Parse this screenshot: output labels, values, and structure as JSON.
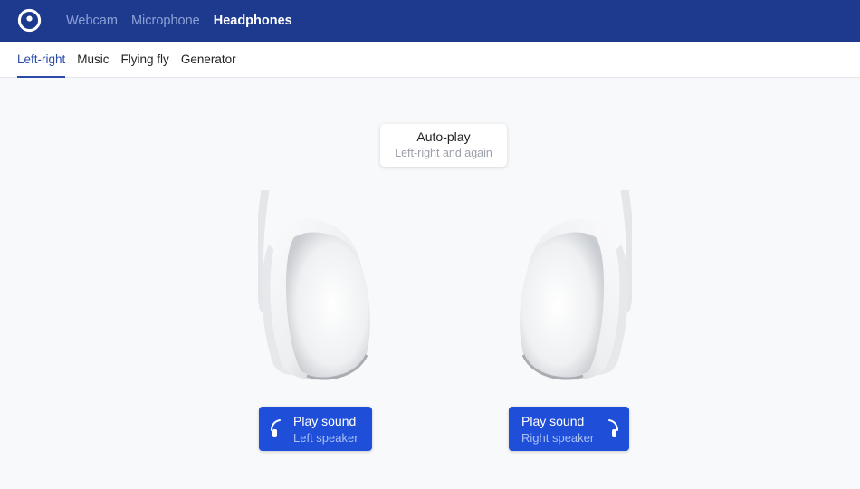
{
  "topnav": {
    "logo_icon": "ring-logo-icon",
    "items": [
      {
        "label": "Webcam",
        "active": false
      },
      {
        "label": "Microphone",
        "active": false
      },
      {
        "label": "Headphones",
        "active": true
      }
    ]
  },
  "subnav": {
    "tabs": [
      {
        "label": "Left-right",
        "active": true
      },
      {
        "label": "Music",
        "active": false
      },
      {
        "label": "Flying fly",
        "active": false
      },
      {
        "label": "Generator",
        "active": false
      }
    ]
  },
  "autoplay": {
    "title": "Auto-play",
    "subtitle": "Left-right and again"
  },
  "left_button": {
    "title": "Play sound",
    "subtitle": "Left speaker",
    "icon": "left-headphone-icon"
  },
  "right_button": {
    "title": "Play sound",
    "subtitle": "Right speaker",
    "icon": "right-headphone-icon"
  },
  "colors": {
    "header_bg": "#1d3a8f",
    "accent": "#1f4fd8",
    "active_tab": "#2b4aa8"
  }
}
